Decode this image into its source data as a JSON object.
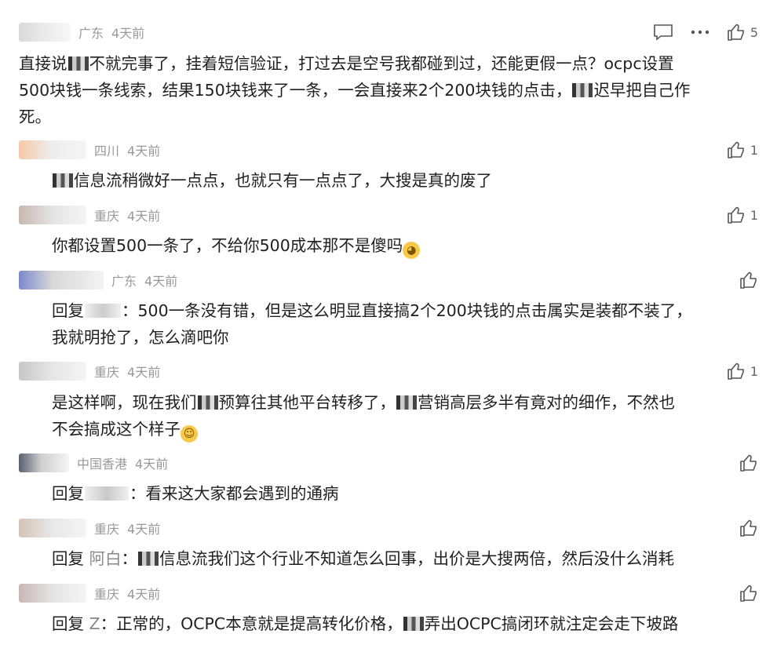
{
  "comments": [
    {
      "region": "广东",
      "time": "4天前",
      "likes": "5",
      "text_a": "直接说",
      "text_b": "不就完事了，挂着短信验证，打过去是空号我都碰到过，还能更假一点？ocpc设置",
      "line2_a": "500块钱一条线索，结果150块钱来了一条，一会直接来2个200块钱的点击，",
      "line2_b": "迟早把自己作",
      "line3": "死。"
    },
    {
      "region": "四川",
      "time": "4天前",
      "likes": "1",
      "text": "信息流稍微好一点点，也就只有一点点了，大搜是真的废了"
    },
    {
      "region": "重庆",
      "time": "4天前",
      "likes": "1",
      "text": "你都设置500一条了，不给你500成本那不是傻吗"
    },
    {
      "region": "广东",
      "time": "4天前",
      "reply_prefix": "回复",
      "text": "：500一条没有错，但是这么明显直接搞2个200块钱的点击属实是装都不装了，",
      "line2": "我就明抢了，怎么滴吧你"
    },
    {
      "region": "重庆",
      "time": "4天前",
      "likes": "1",
      "text_a": "是这样啊，现在我们",
      "text_b": "预算往其他平台转移了，",
      "text_c": "营销高层多半有竟对的细作，不然也",
      "line2": "不会搞成这个样子"
    },
    {
      "region": "中国香港",
      "time": "4天前",
      "reply_prefix": "回复",
      "text": "：看来这大家都会遇到的通病"
    },
    {
      "region": "重庆",
      "time": "4天前",
      "reply_prefix": "回复",
      "reply_name": "阿白",
      "text": "：",
      "text_b": "信息流我们这个行业不知道怎么回事，出价是大搜两倍，然后没什么消耗"
    },
    {
      "region": "重庆",
      "time": "4天前",
      "reply_prefix": "回复",
      "reply_name": "Z",
      "text": "：正常的，OCPC本意就是提高转化价格，",
      "text_b": "弄出OCPC搞闭环就注定会走下坡路"
    }
  ]
}
